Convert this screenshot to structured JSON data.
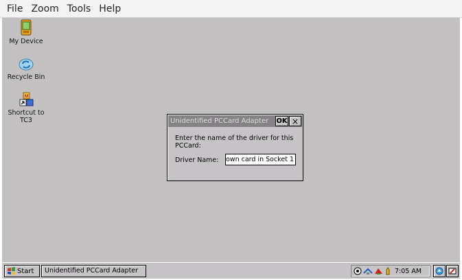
{
  "menubar": {
    "items": [
      "File",
      "Zoom",
      "Tools",
      "Help"
    ]
  },
  "desktop": {
    "icons": [
      {
        "label": "My Device",
        "icon": "pda-device-icon"
      },
      {
        "label": "Recycle Bin",
        "icon": "recycle-bin-icon"
      },
      {
        "label": "Shortcut to TC3",
        "icon": "shortcut-tc3-icon"
      }
    ]
  },
  "dialog": {
    "title": "Unidentified PCCard Adapter",
    "ok_label": "OK",
    "close_label": "×",
    "message": "Enter the name of the driver for this PCCard:",
    "driver_label": "Driver Name:",
    "driver_value": "own card in Socket 1"
  },
  "taskbar": {
    "start_label": "Start",
    "task_label": "Unidentified PCCard Adapter",
    "clock": "7:05 AM",
    "tray_icons": [
      "network-icon",
      "connection-icon",
      "pccard-icon",
      "touch-icon"
    ],
    "extra_buttons": [
      "desktop-icon",
      "input-panel-icon"
    ]
  }
}
